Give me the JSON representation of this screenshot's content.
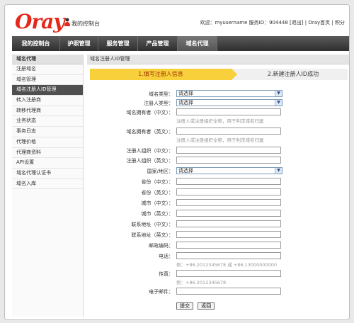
{
  "header": {
    "logo": "Oray",
    "logo_sub": "我的控制台",
    "welcome": "欢迎：myusername 服务ID：904448",
    "logout": "[退出]",
    "home": "Oray首页",
    "points": "积分"
  },
  "nav": [
    "我的控制台",
    "护照管理",
    "服务管理",
    "产品管理",
    "域名代理"
  ],
  "sidebar": {
    "title": "域名代理",
    "items": [
      "注册域名",
      "域名管理",
      "域名注册人ID管理",
      "转入注册商",
      "转移代理商",
      "业务状态",
      "事务日志",
      "代理价格",
      "代理商资料",
      "API设置",
      "域名代理认证书",
      "域名入库"
    ]
  },
  "content": {
    "title": "域名注册人ID管理",
    "step1": "1.填写注册人信息",
    "step2": "2.新建注册人ID成功",
    "fields": {
      "domain_type": "域名类型：",
      "registrant_type": "注册人类型：",
      "owner_cn": "域名拥有者（中文）：",
      "owner_hint_cn": "注册人或注册组织全称，用于判定域名归属",
      "owner_en": "域名拥有者（英文）：",
      "owner_hint_en": "注册人或注册组织全称，用于判定域名归属",
      "org_cn": "注册人组织（中文）：",
      "org_en": "注册人组织（英文）：",
      "country": "国家/地区：",
      "province_cn": "省份（中文）：",
      "province_en": "省份（英文）：",
      "city_cn": "城市（中文）：",
      "city_en": "城市（英文）：",
      "addr_cn": "联系地址（中文）：",
      "addr_en": "联系地址（英文）：",
      "postcode": "邮政编码：",
      "phone": "电话：",
      "phone_hint": "例：+86.2012345678 或 +86.13000000000",
      "fax": "传真：",
      "fax_hint": "例：+86.2012345678",
      "email": "电子邮件："
    },
    "select_value": "请选择",
    "submit": "提交",
    "back": "返回"
  }
}
